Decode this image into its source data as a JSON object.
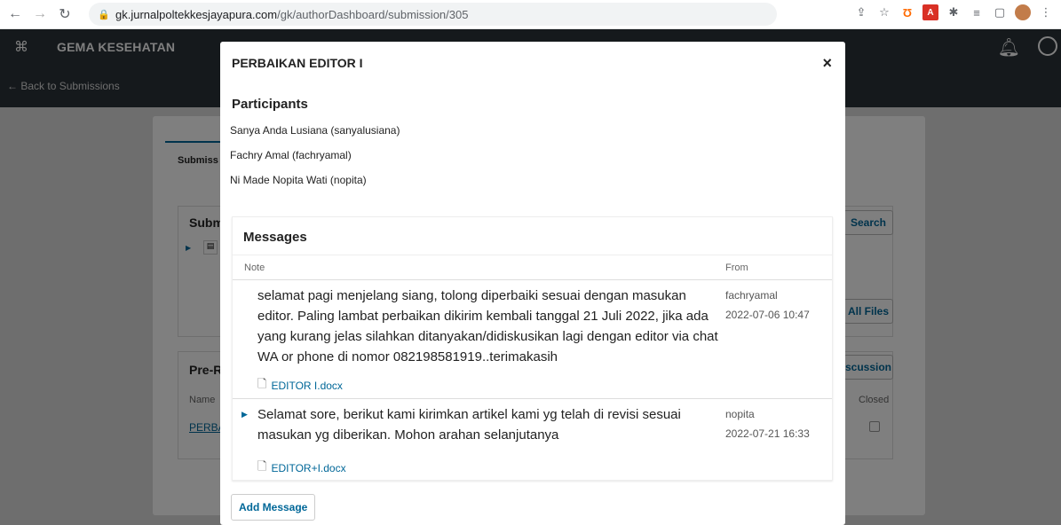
{
  "browser": {
    "url_host": "gk.jurnalpoltekkesjayapura.com",
    "url_path": "/gk/authorDashboard/submission/305"
  },
  "app": {
    "brand": "GEMA KESEHATAN",
    "back_label": "Back to Submissions"
  },
  "background": {
    "tab_label": "Submiss",
    "box1_title": "Subm",
    "box2_title": "Pre-R",
    "col_name": "Name",
    "col_closed": "Closed",
    "row_name": "PERBA",
    "btn_search": "Search",
    "btn_all_files": "All Files",
    "btn_discussion": "scussion"
  },
  "modal": {
    "title": "PERBAIKAN EDITOR I",
    "participants_title": "Participants",
    "participants": [
      "Sanya Anda Lusiana (sanyalusiana)",
      "Fachry Amal (fachryamal)",
      "Ni Made Nopita Wati (nopita)"
    ],
    "messages_title": "Messages",
    "col_note": "Note",
    "col_from": "From",
    "messages": [
      {
        "text": "selamat pagi menjelang siang, tolong diperbaiki sesuai dengan masukan editor. Paling lambat perbaikan dikirim kembali tanggal 21 Juli 2022, jika ada yang kurang jelas silahkan ditanyakan/didiskusikan lagi dengan editor via chat WA or phone di nomor 082198581919..terimakasih",
        "attachment": "EDITOR I.docx",
        "author": "fachryamal",
        "date": "2022-07-06 10:47"
      },
      {
        "text": "Selamat sore, berikut kami kirimkan artikel kami yg telah di revisi sesuai masukan yg diberikan. Mohon arahan selanjutanya",
        "attachment": "EDITOR+I.docx",
        "author": "nopita",
        "date": "2022-07-21 16:33"
      }
    ],
    "add_message_label": "Add Message"
  }
}
